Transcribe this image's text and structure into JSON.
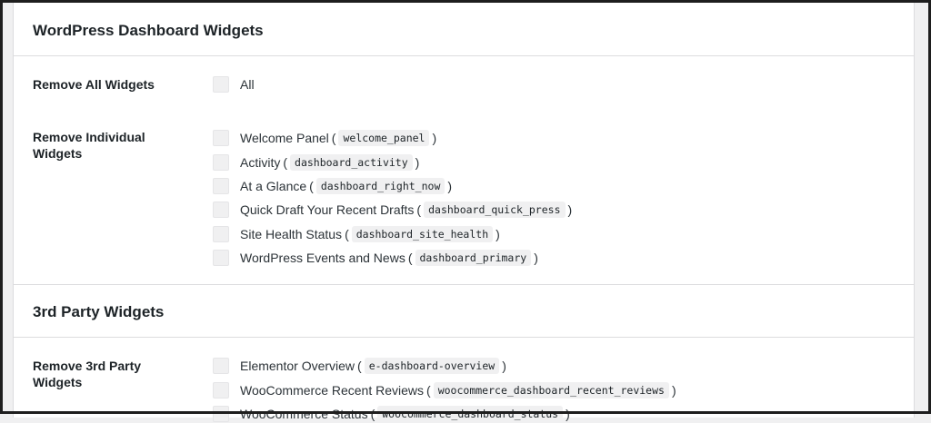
{
  "sections": [
    {
      "title": "WordPress Dashboard Widgets",
      "rows": [
        {
          "label": "Remove All Widgets",
          "options": [
            {
              "label": "All",
              "code": ""
            }
          ]
        },
        {
          "label": "Remove Individual Widgets",
          "options": [
            {
              "label": "Welcome Panel",
              "code": "welcome_panel"
            },
            {
              "label": "Activity",
              "code": "dashboard_activity"
            },
            {
              "label": "At a Glance",
              "code": "dashboard_right_now"
            },
            {
              "label": "Quick Draft Your Recent Drafts",
              "code": "dashboard_quick_press"
            },
            {
              "label": "Site Health Status",
              "code": "dashboard_site_health"
            },
            {
              "label": "WordPress Events and News",
              "code": "dashboard_primary"
            }
          ]
        }
      ]
    },
    {
      "title": "3rd Party Widgets",
      "rows": [
        {
          "label": "Remove 3rd Party Widgets",
          "options": [
            {
              "label": "Elementor Overview",
              "code": "e-dashboard-overview"
            },
            {
              "label": "WooCommerce Recent Reviews",
              "code": "woocommerce_dashboard_recent_reviews"
            },
            {
              "label": "WooCommerce Status",
              "code": "woocommerce_dashboard_status"
            }
          ]
        }
      ]
    }
  ]
}
